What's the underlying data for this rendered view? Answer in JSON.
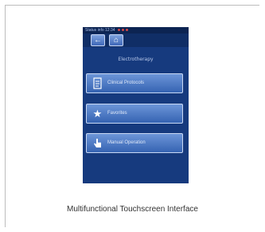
{
  "device": {
    "status_text": "Status info 12:34",
    "screen_title": "Electrotherapy",
    "nav": {
      "back_icon": "arrow-left-icon",
      "home_icon": "home-icon"
    },
    "menu": [
      {
        "label": "Clinical Protocols",
        "icon": "document-icon"
      },
      {
        "label": "Favorites",
        "icon": "star-icon"
      },
      {
        "label": "Manual Operation",
        "icon": "hand-pointer-icon"
      }
    ]
  },
  "caption": "Multifunctional Touchscreen Interface",
  "colors": {
    "screen_bg": "#163a7e",
    "button_top": "#6c95d8",
    "button_bottom": "#3563b2"
  }
}
